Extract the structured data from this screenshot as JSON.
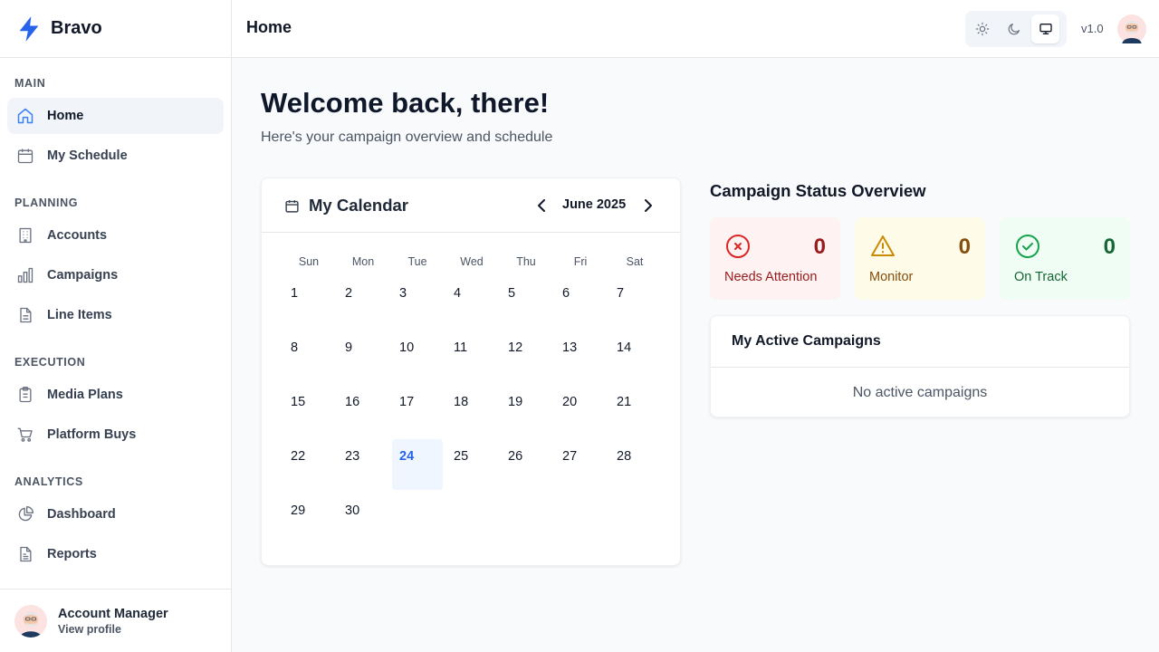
{
  "app": {
    "name": "Bravo",
    "version": "v1.0"
  },
  "colors": {
    "accent": "#2563eb",
    "needs_attention": "#dc2626",
    "monitor": "#ca8a04",
    "on_track": "#16a34a"
  },
  "sidebar": {
    "sections": [
      {
        "title": "MAIN",
        "items": [
          {
            "label": "Home",
            "icon": "home-icon",
            "active": true
          },
          {
            "label": "My Schedule",
            "icon": "calendar-icon"
          }
        ]
      },
      {
        "title": "PLANNING",
        "items": [
          {
            "label": "Accounts",
            "icon": "building-icon"
          },
          {
            "label": "Campaigns",
            "icon": "bar-chart-icon"
          },
          {
            "label": "Line Items",
            "icon": "file-icon"
          }
        ]
      },
      {
        "title": "EXECUTION",
        "items": [
          {
            "label": "Media Plans",
            "icon": "clipboard-icon"
          },
          {
            "label": "Platform Buys",
            "icon": "cart-icon"
          }
        ]
      },
      {
        "title": "ANALYTICS",
        "items": [
          {
            "label": "Dashboard",
            "icon": "pie-chart-icon"
          },
          {
            "label": "Reports",
            "icon": "report-icon"
          }
        ]
      }
    ],
    "user": {
      "name": "Account Manager",
      "link": "View profile"
    }
  },
  "header": {
    "title": "Home",
    "theme_options": [
      "sun-icon",
      "moon-icon",
      "monitor-icon"
    ],
    "theme_selected": "monitor-icon"
  },
  "main": {
    "welcome": "Welcome back, there!",
    "subtitle": "Here's your campaign overview and schedule",
    "calendar": {
      "title": "My Calendar",
      "month": "June 2025",
      "weekdays": [
        "Sun",
        "Mon",
        "Tue",
        "Wed",
        "Thu",
        "Fri",
        "Sat"
      ],
      "days": [
        "1",
        "2",
        "3",
        "4",
        "5",
        "6",
        "7",
        "8",
        "9",
        "10",
        "11",
        "12",
        "13",
        "14",
        "15",
        "16",
        "17",
        "18",
        "19",
        "20",
        "21",
        "22",
        "23",
        "24",
        "25",
        "26",
        "27",
        "28",
        "29",
        "30"
      ],
      "today": "24"
    },
    "status": {
      "title": "Campaign Status Overview",
      "cards": [
        {
          "label": "Needs Attention",
          "count": "0",
          "icon": "x-circle-icon"
        },
        {
          "label": "Monitor",
          "count": "0",
          "icon": "warning-icon"
        },
        {
          "label": "On Track",
          "count": "0",
          "icon": "check-circle-icon"
        }
      ]
    },
    "active_campaigns": {
      "title": "My Active Campaigns",
      "empty": "No active campaigns"
    }
  }
}
